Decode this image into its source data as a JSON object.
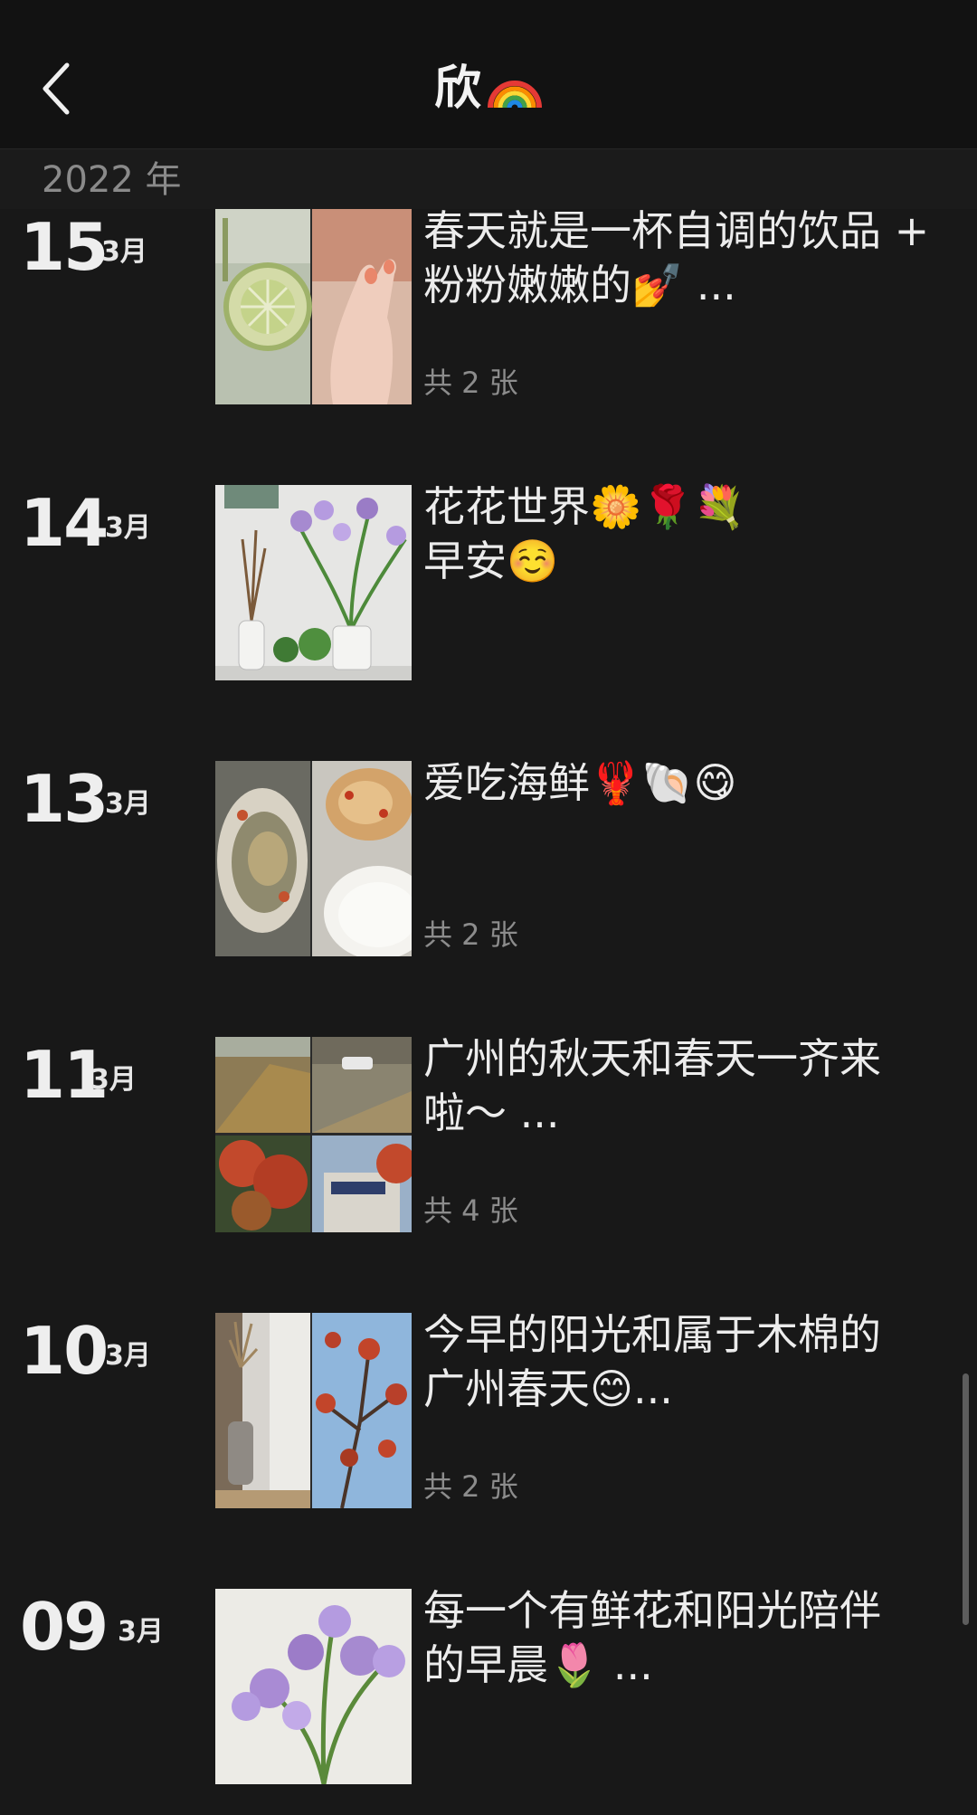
{
  "header": {
    "title": "欣",
    "back_icon": "chevron-left-icon",
    "title_emoji": "rainbow-icon"
  },
  "year_bar": {
    "label": "2022 年"
  },
  "entries": [
    {
      "day": "15",
      "month": "3月",
      "caption": "春天就是一杯自调的饮品 +\n粉粉嫩嫩的💅 ...",
      "count": "共 2 张"
    },
    {
      "day": "14",
      "month": "3月",
      "caption": "花花世界🌼🌹💐\n早安☺️",
      "count": ""
    },
    {
      "day": "13",
      "month": "3月",
      "caption": "爱吃海鲜🦞🐚😋",
      "count": "共 2 张"
    },
    {
      "day": "11",
      "month": "3月",
      "caption": "广州的秋天和春天一齐来\n啦～ ...",
      "count": "共 4 张"
    },
    {
      "day": "10",
      "month": "3月",
      "caption": "今早的阳光和属于木棉的\n广州春天😊...",
      "count": "共 2 张"
    },
    {
      "day": "09",
      "month": "3月",
      "caption": "每一个有鲜花和阳光陪伴\n的早晨🌷 ...",
      "count": ""
    }
  ],
  "scrollbar": {
    "position_percent": 78
  }
}
